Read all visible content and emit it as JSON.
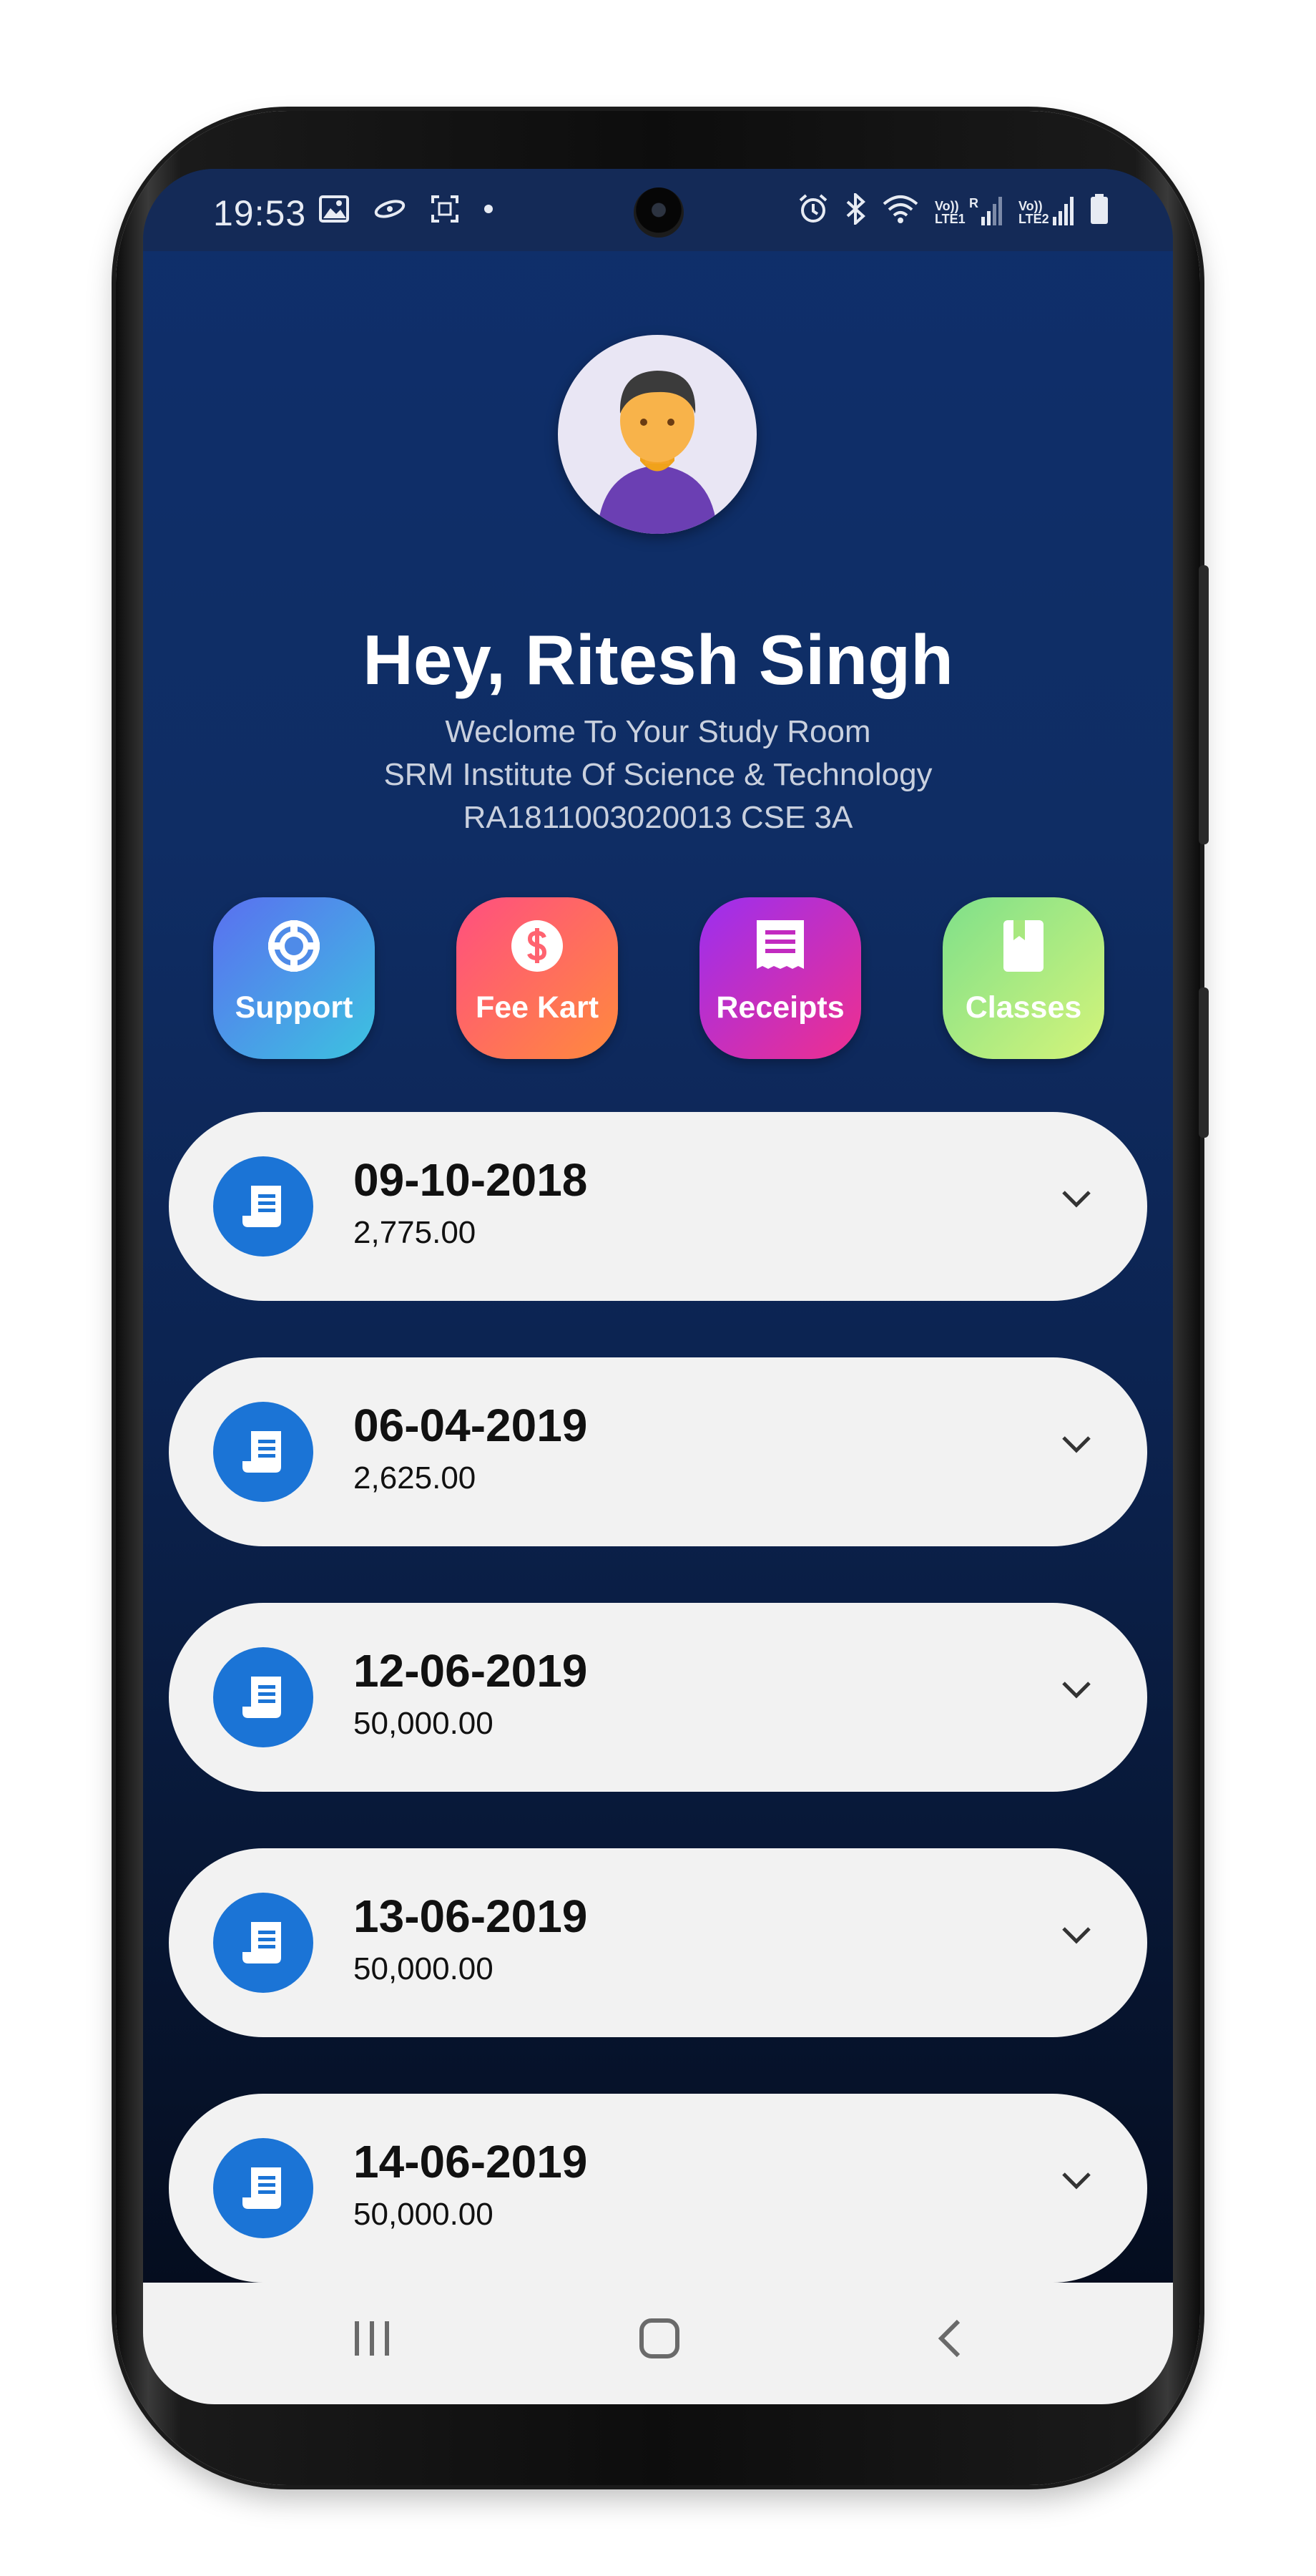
{
  "status_bar": {
    "time": "19:53",
    "left_icons": [
      "gallery-icon",
      "sync-icon",
      "screenshot-icon",
      "dot-icon"
    ],
    "right_icons": [
      "alarm-icon",
      "bluetooth-icon",
      "wifi-icon",
      "signal-sim1-icon",
      "signal-sim2-icon",
      "battery-icon"
    ],
    "sim1_label": "Vo)) LTE1",
    "sim2_label": "Vo)) LTE2",
    "roaming": "R"
  },
  "profile": {
    "greeting": "Hey, Ritesh Singh",
    "welcome": "Weclome To Your Study Room",
    "institute": "SRM Institute Of Science & Technology",
    "reg_info": "RA1811003020013 CSE 3A"
  },
  "quick_actions": [
    {
      "label": "Support",
      "icon": "lifebuoy-icon",
      "gradient": [
        "#5a6ff0",
        "#3cc3e0"
      ]
    },
    {
      "label": "Fee Kart",
      "icon": "dollar-icon",
      "gradient": [
        "#ff4f80",
        "#ff8a3d"
      ]
    },
    {
      "label": "Receipts",
      "icon": "receipt-list-icon",
      "gradient": [
        "#9b2ff0",
        "#ef2f8e"
      ]
    },
    {
      "label": "Classes",
      "icon": "book-icon",
      "gradient": [
        "#7fe08a",
        "#d4f47a"
      ]
    }
  ],
  "receipts": [
    {
      "date": "09-10-2018",
      "amount": "2,775.00"
    },
    {
      "date": "06-04-2019",
      "amount": "2,625.00"
    },
    {
      "date": "12-06-2019",
      "amount": "50,000.00"
    },
    {
      "date": "13-06-2019",
      "amount": "50,000.00"
    },
    {
      "date": "14-06-2019",
      "amount": "50,000.00"
    }
  ],
  "nav_bar": {
    "buttons": [
      "recent-apps-icon",
      "home-icon",
      "back-icon"
    ]
  },
  "colors": {
    "accent": "#1b74d6",
    "background_top": "#0f2f6b",
    "card": "#f2f2f2"
  }
}
